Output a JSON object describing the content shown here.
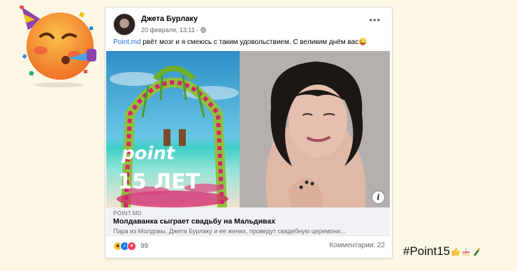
{
  "post": {
    "author": "Джета Бурлаку",
    "date": "20 февраля, 13:11 ·",
    "link_text": "Point.md",
    "text": " рвёт мозг и я смеюсь с таким удовольствием. С великим днём вас😜",
    "image_overlay_brand": "point",
    "image_overlay_text": "15 ЛЕТ",
    "more_label": "•••"
  },
  "link_preview": {
    "domain": "POINT.MD",
    "title": "Молдаванка сыграет свадьбу на Мальдивах",
    "description": "Пара из Молдовы, Джета Бурлаку и ее жених, проведут свадебную церемони..."
  },
  "footer": {
    "reactions_count": "99",
    "comments": "Комментарии: 22"
  },
  "hashtag": "#Point15",
  "icons": {
    "party": "party-face-emoji",
    "globe": "globe-icon",
    "info": "info-icon",
    "more": "more-icon"
  },
  "colors": {
    "background": "#fdf8e6",
    "link": "#216fdb",
    "like": "#1877f2",
    "love": "#f33e58",
    "haha": "#f5c33b"
  }
}
